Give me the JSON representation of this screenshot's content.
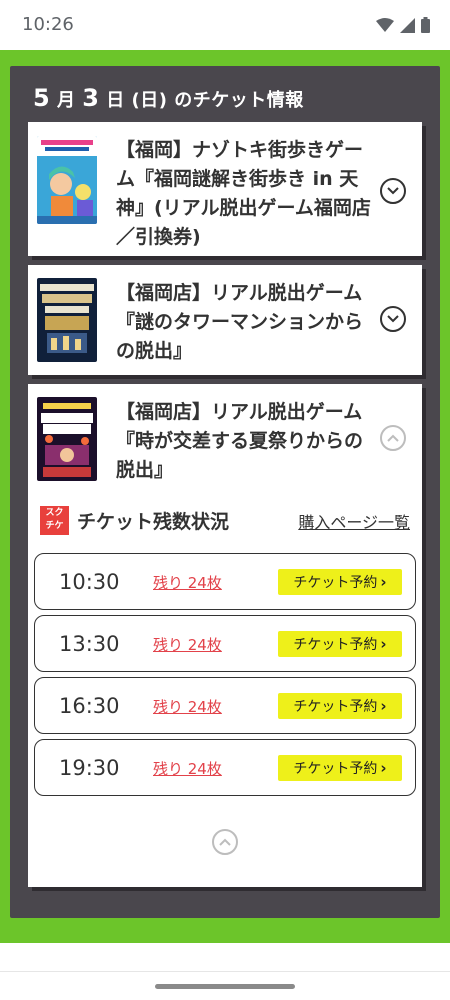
{
  "status": {
    "time": "10:26"
  },
  "header": {
    "month": "5",
    "month_unit": "月",
    "day": "3",
    "day_unit": "日",
    "weekday": "(日)",
    "suffix": "のチケット情報"
  },
  "cards": [
    {
      "title": "【福岡】ナゾトキ街歩きゲーム『福岡謎解き街歩き in 天神』(リアル脱出ゲーム福岡店／引換券)",
      "expanded": false
    },
    {
      "title": "【福岡店】リアル脱出ゲーム『謎のタワーマンションからの脱出』",
      "expanded": false
    },
    {
      "title": "【福岡店】リアル脱出ゲーム『時が交差する夏祭りからの脱出』",
      "expanded": true
    }
  ],
  "remaining": {
    "logo_line1": "スク",
    "logo_line2": "チケ",
    "title": "チケット残数状況",
    "list_link": "購入ページ一覧",
    "slots": [
      {
        "time": "10:30",
        "remain": "残り 24枚",
        "button": "チケット予約"
      },
      {
        "time": "13:30",
        "remain": "残り 24枚",
        "button": "チケット予約"
      },
      {
        "time": "16:30",
        "remain": "残り 24枚",
        "button": "チケット予約"
      },
      {
        "time": "19:30",
        "remain": "残り 24枚",
        "button": "チケット予約"
      }
    ]
  },
  "colors": {
    "frame": "#6cc52a",
    "panel": "#4a474d",
    "button": "#eef01a",
    "remain": "#e2424a"
  }
}
